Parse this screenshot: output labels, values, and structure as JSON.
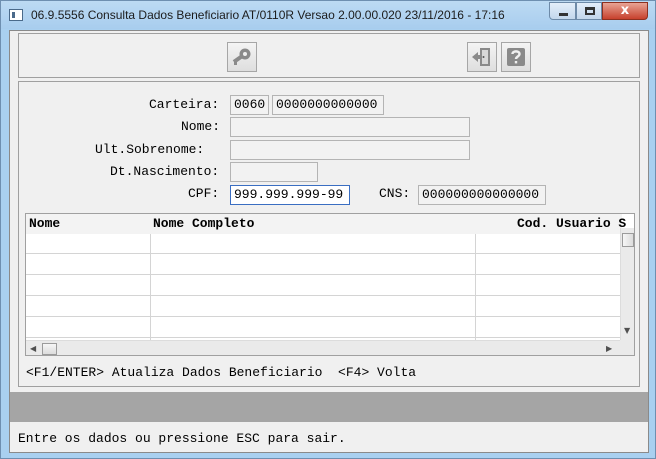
{
  "window": {
    "title": "06.9.5556  Consulta Dados Beneficiario AT/0110R Versao 2.00.00.020 23/11/2016 - 17:16",
    "close_glyph": "x"
  },
  "toolbar": {
    "key_icon": "key-icon",
    "exit_icon": "exit-door-icon",
    "help_icon": "help-question-icon"
  },
  "form": {
    "carteira_label": "Carteira:",
    "carteira_prefix": "0060",
    "carteira_number": "0000000000000",
    "nome_label": "Nome:",
    "nome_value": "",
    "sobrenome_label": "Ult.Sobrenome:",
    "sobrenome_value": "",
    "nascimento_label": "Dt.Nascimento:",
    "nascimento_value": "",
    "cpf_label": "CPF:",
    "cpf_value": "999.999.999-99",
    "cns_label": "CNS:",
    "cns_value": "000000000000000"
  },
  "grid": {
    "columns": [
      "Nome",
      "Nome Completo",
      "Cod. Usuario S"
    ],
    "rows": [
      [
        "",
        "",
        ""
      ],
      [
        "",
        "",
        ""
      ],
      [
        "",
        "",
        ""
      ],
      [
        "",
        "",
        ""
      ],
      [
        "",
        "",
        ""
      ]
    ]
  },
  "shortcuts": "<F1/ENTER> Atualiza Dados Beneficiario  <F4> Volta",
  "status": "Entre os dados ou pressione ESC para sair.",
  "colors": {
    "titlebar": "#a9d0f0",
    "dialog_bg": "#f0f0f0",
    "band": "#a5a5a5",
    "close_button": "#c7412d"
  }
}
